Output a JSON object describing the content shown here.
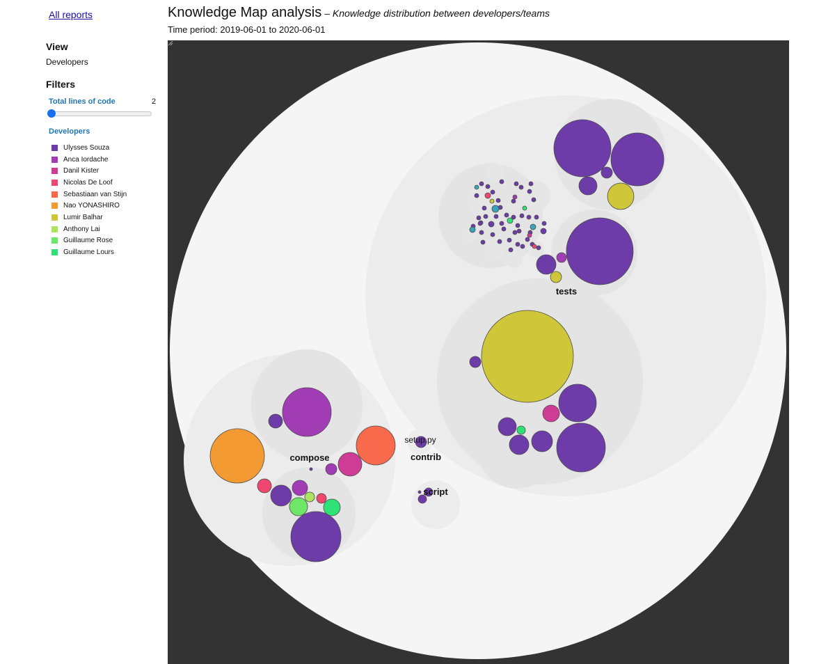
{
  "nav": {
    "all_reports": "All reports"
  },
  "header": {
    "title": "Knowledge Map analysis",
    "subtitle": "– Knowledge distribution between developers/teams",
    "period_label": "Time period:",
    "period_range": "2019-06-01 to 2020-06-01"
  },
  "sidebar": {
    "view_title": "View",
    "view_value": "Developers",
    "filters_title": "Filters",
    "loc_label": "Total lines of code",
    "loc_value": "2",
    "loc_slider_fraction": 0,
    "developers_title": "Developers"
  },
  "developers": [
    {
      "name": "Ulysses Souza",
      "color": "#6e3ca8"
    },
    {
      "name": "Anca Iordache",
      "color": "#a23cb4"
    },
    {
      "name": "Danil Kister",
      "color": "#cf3c95"
    },
    {
      "name": "Nicolas De Loof",
      "color": "#ef4770"
    },
    {
      "name": "Sebastiaan van Stijn",
      "color": "#f96a4d"
    },
    {
      "name": "Nao YONASHIRO",
      "color": "#f39a32"
    },
    {
      "name": "Lumir Balhar",
      "color": "#d0c63a"
    },
    {
      "name": "Anthony Lai",
      "color": "#aee35f"
    },
    {
      "name": "Guillaume Rose",
      "color": "#6ee769"
    },
    {
      "name": "Guillaume Lours",
      "color": "#2fe277"
    }
  ],
  "map_labels": {
    "tests": "tests",
    "compose": "compose",
    "contrib": "contrib",
    "setup": "setup.py",
    "script": "script"
  }
}
